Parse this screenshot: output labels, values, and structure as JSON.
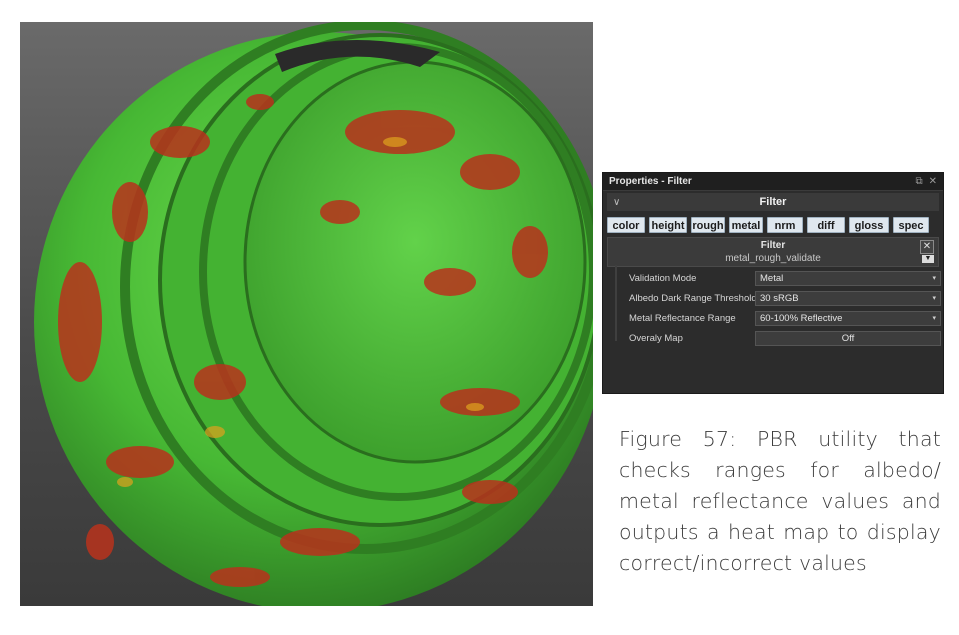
{
  "panel": {
    "title": "Properties - Filter",
    "popout_icon": "⧉",
    "close_icon": "✕",
    "section_label": "Filter",
    "map_buttons": [
      {
        "label": "color"
      },
      {
        "label": "height"
      },
      {
        "label": "rough"
      },
      {
        "label": "metal"
      },
      {
        "label": "nrm"
      },
      {
        "label": "diff"
      },
      {
        "label": "gloss"
      },
      {
        "label": "spec"
      }
    ],
    "filter_box": {
      "title": "Filter",
      "name": "metal_rough_validate"
    },
    "properties": [
      {
        "label": "Validation Mode",
        "value": "Metal"
      },
      {
        "label": "Albedo Dark Range Threshold",
        "value": "30 sRGB"
      },
      {
        "label": "Metal Reflectance Range",
        "value": "60-100% Reflective"
      },
      {
        "label": "Overaly Map",
        "value": "Off"
      }
    ]
  },
  "caption": "Figure 57: PBR utility that checks ranges for albedo/ metal reflectance values and outputs a heat map to display correct/incorrect values",
  "colors": {
    "heatmap_green": "#4cc43a",
    "heatmap_red": "#b8321c",
    "panel_bg": "#2c2c2c",
    "button_bg": "#dfe7ee"
  }
}
